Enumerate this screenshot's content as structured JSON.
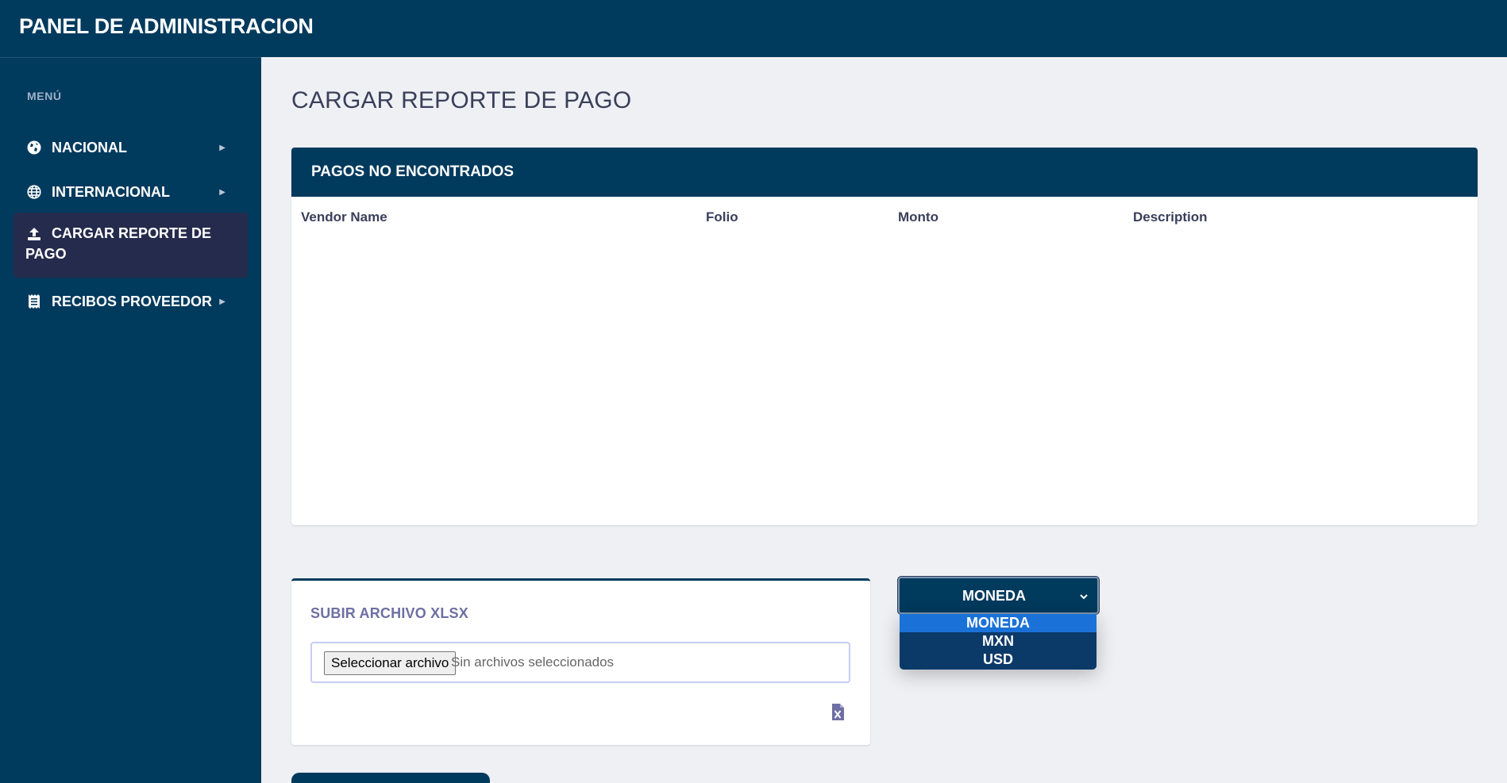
{
  "header": {
    "title": "PANEL DE ADMINISTRACION"
  },
  "sidebar": {
    "menu_title": "MENÚ",
    "items": [
      {
        "label": "NACIONAL",
        "icon": "globe-americas-icon"
      },
      {
        "label": "INTERNACIONAL",
        "icon": "globe-icon"
      },
      {
        "label": "CARGAR REPORTE DE PAGO",
        "icon": "upload-icon"
      },
      {
        "label": "RECIBOS PROVEEDOR",
        "icon": "receipt-icon"
      }
    ]
  },
  "main": {
    "page_title": "CARGAR REPORTE DE PAGO",
    "table": {
      "title": "PAGOS NO ENCONTRADOS",
      "columns": [
        "Vendor Name",
        "Folio",
        "Monto",
        "Description"
      ]
    },
    "upload": {
      "title": "SUBIR ARCHIVO XLSX",
      "button_label": "Seleccionar archivo",
      "status": "Sin archivos seleccionados"
    },
    "currency": {
      "selected": "MONEDA",
      "options": [
        "MONEDA",
        "MXN",
        "USD"
      ]
    }
  },
  "colors": {
    "primary": "#003a5d",
    "active_nav": "#252b4c",
    "option_highlight": "#1a72d8",
    "background": "#eef0f4"
  }
}
